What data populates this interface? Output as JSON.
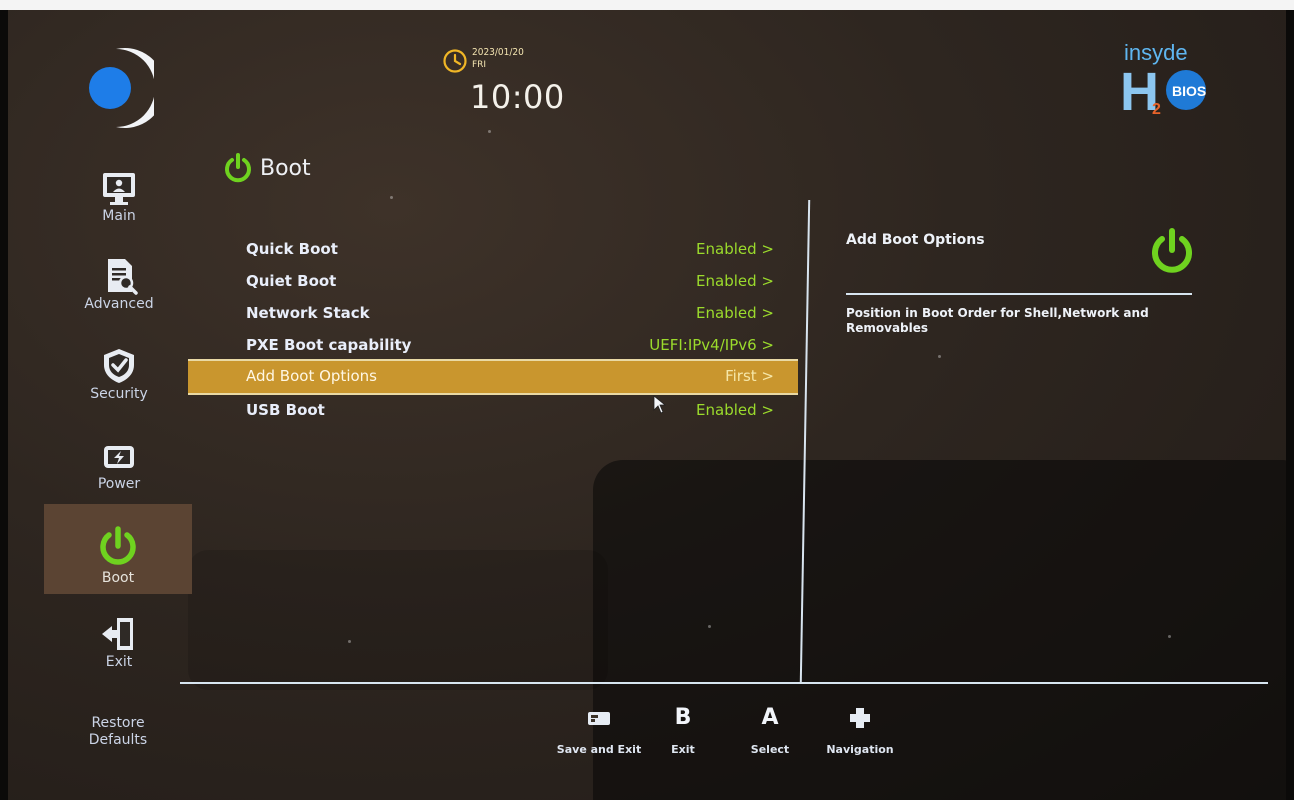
{
  "clock": {
    "date": "2023/01/20",
    "day": "FRI",
    "time": "10:00"
  },
  "brand": {
    "text": "insyde",
    "sub": "H",
    "sub2": "2",
    "bios": "BIOS"
  },
  "sidebar": {
    "items": [
      {
        "label": "Main",
        "icon": "monitor-icon"
      },
      {
        "label": "Advanced",
        "icon": "document-search-icon"
      },
      {
        "label": "Security",
        "icon": "shield-icon"
      },
      {
        "label": "Power",
        "icon": "battery-icon"
      },
      {
        "label": "Boot",
        "icon": "power-icon",
        "active": true
      },
      {
        "label": "Exit",
        "icon": "exit-door-icon"
      }
    ],
    "restore_label": "Restore Defaults"
  },
  "page": {
    "title": "Boot"
  },
  "settings": [
    {
      "label": "Quick Boot",
      "value": "Enabled >"
    },
    {
      "label": "Quiet Boot",
      "value": "Enabled >"
    },
    {
      "label": "Network Stack",
      "value": "Enabled >"
    },
    {
      "label": "PXE Boot capability",
      "value": "UEFI:IPv4/IPv6 >"
    },
    {
      "label": "Add Boot Options",
      "value": "First >",
      "selected": true
    },
    {
      "label": "USB Boot",
      "value": "Enabled >"
    }
  ],
  "help": {
    "title": "Add Boot Options",
    "text": "Position in Boot Order for Shell,Network and Removables"
  },
  "footer": {
    "keys": [
      {
        "glyph": "",
        "icon": "save-exit-icon",
        "label": "Save and Exit"
      },
      {
        "glyph": "B",
        "label": "Exit"
      },
      {
        "glyph": "A",
        "label": "Select"
      },
      {
        "glyph": "",
        "icon": "dpad-icon",
        "label": "Navigation"
      }
    ]
  },
  "colors": {
    "background": "#2e2620",
    "accent_selected": "#c9962e",
    "value_green": "#9bdb2c",
    "active_tab": "#5b4433",
    "power_icon_green": "#6fd21f"
  }
}
